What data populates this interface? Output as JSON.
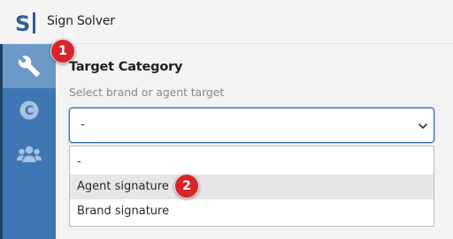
{
  "app": {
    "title": "Sign Solver",
    "logo_icon": "sign-solver-logo"
  },
  "sidebar": {
    "items": [
      {
        "icon": "wrench-icon",
        "active": true
      },
      {
        "icon": "copyright-icon",
        "active": false
      },
      {
        "icon": "users-icon",
        "active": false
      }
    ],
    "colors": {
      "bg": "#3f77b4",
      "active": "#6d99c9"
    }
  },
  "form": {
    "title": "Target Category",
    "subtitle": "Select brand or agent target",
    "select": {
      "value": "-"
    },
    "options": [
      {
        "label": "-",
        "highlighted": false
      },
      {
        "label": "Agent signature",
        "highlighted": true
      },
      {
        "label": "Brand signature",
        "highlighted": false
      }
    ]
  },
  "annotations": [
    {
      "label": "1"
    },
    {
      "label": "2"
    }
  ],
  "colors": {
    "accent": "#3a6fb0",
    "badge": "#d6262b"
  }
}
